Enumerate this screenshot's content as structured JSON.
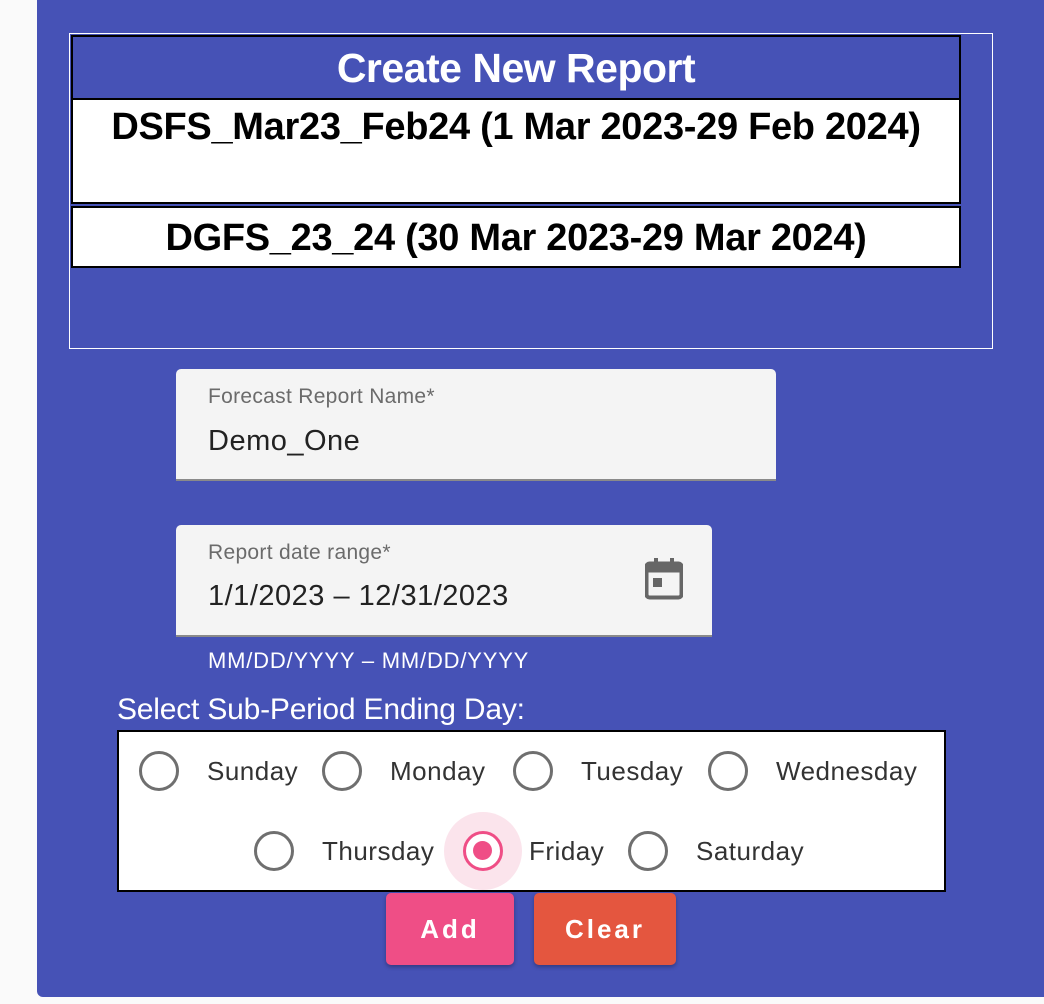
{
  "report_panel": {
    "title": "Create New Report",
    "reports": [
      "DSFS_Mar23_Feb24 (1 Mar 2023-29 Feb 2024)",
      "DGFS_23_24 (30 Mar 2023-29 Mar 2024)"
    ]
  },
  "form": {
    "name_label": "Forecast Report Name*",
    "name_value": "Demo_One",
    "date_label": "Report date range*",
    "date_value": "1/1/2023  – 12/31/2023",
    "date_hint": "MM/DD/YYYY – MM/DD/YYYY"
  },
  "sub_period": {
    "title": "Select Sub-Period Ending Day:",
    "days": [
      "Sunday",
      "Monday",
      "Tuesday",
      "Wednesday",
      "Thursday",
      "Friday",
      "Saturday"
    ],
    "selected": "Friday"
  },
  "actions": {
    "add_label": "Add",
    "clear_label": "Clear"
  },
  "colors": {
    "panel": "#4652b6",
    "accent": "#ef4e86",
    "clear": "#e4563f",
    "calendar_icon": "#666666"
  },
  "icons": {
    "date_picker": "calendar-icon"
  }
}
